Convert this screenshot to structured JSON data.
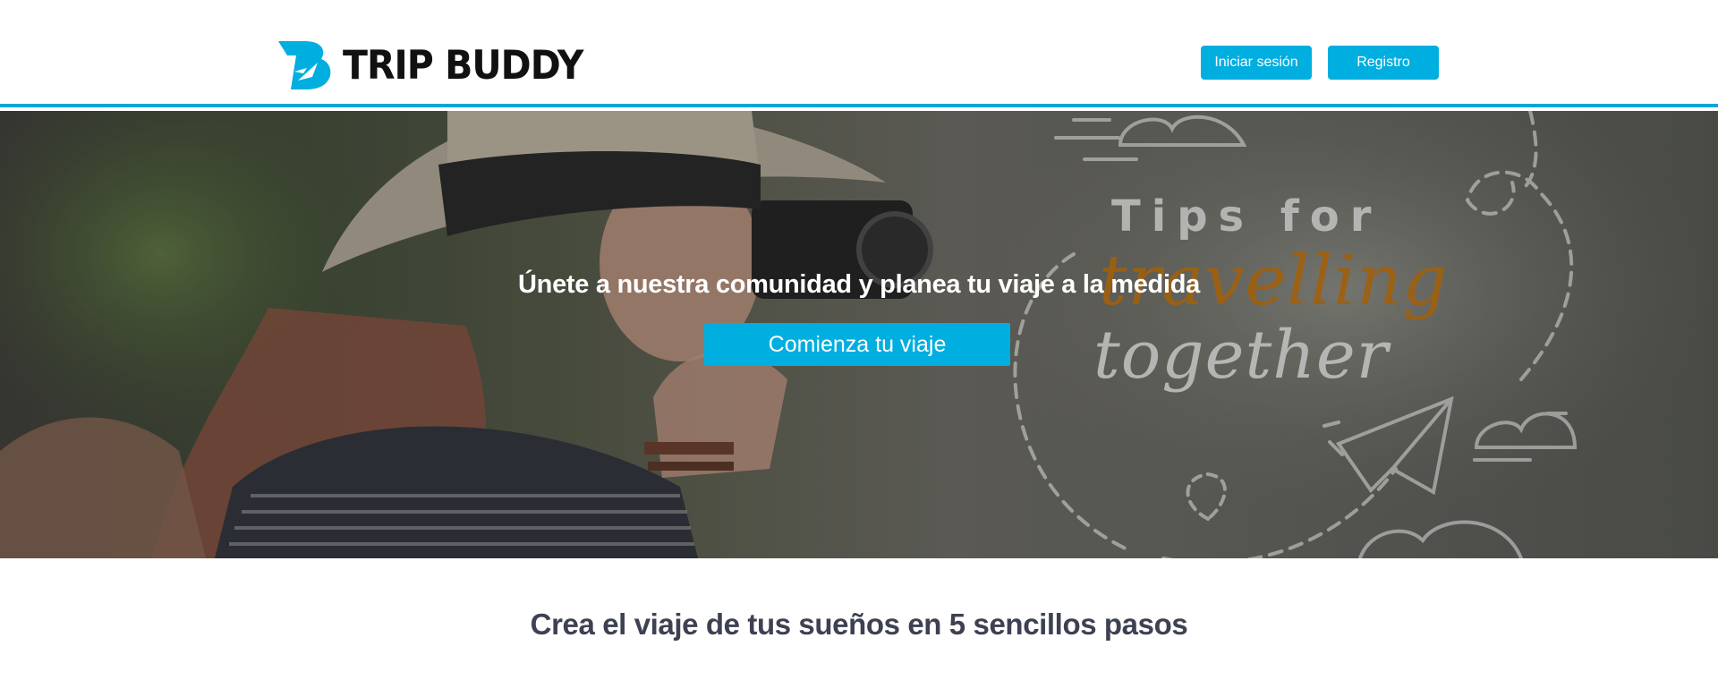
{
  "brand": {
    "name": "TRIP BUDDY",
    "accent_color": "#00aedf",
    "logo_icon": "tripbuddy-logo-icon"
  },
  "header": {
    "login_label": "Iniciar sesión",
    "register_label": "Registro"
  },
  "hero": {
    "title": "Únete a nuestra comunidad y planea tu viaje a la medida",
    "cta_label": "Comienza tu viaje",
    "artwork_line1": "Tips for",
    "artwork_line2": "travelling",
    "artwork_line3": "together",
    "artwork_icons": [
      "paper-plane-icon",
      "cloud-icon",
      "dashed-path"
    ]
  },
  "steps_section": {
    "title": "Crea el viaje de tus sueños en 5 sencillos pasos"
  }
}
